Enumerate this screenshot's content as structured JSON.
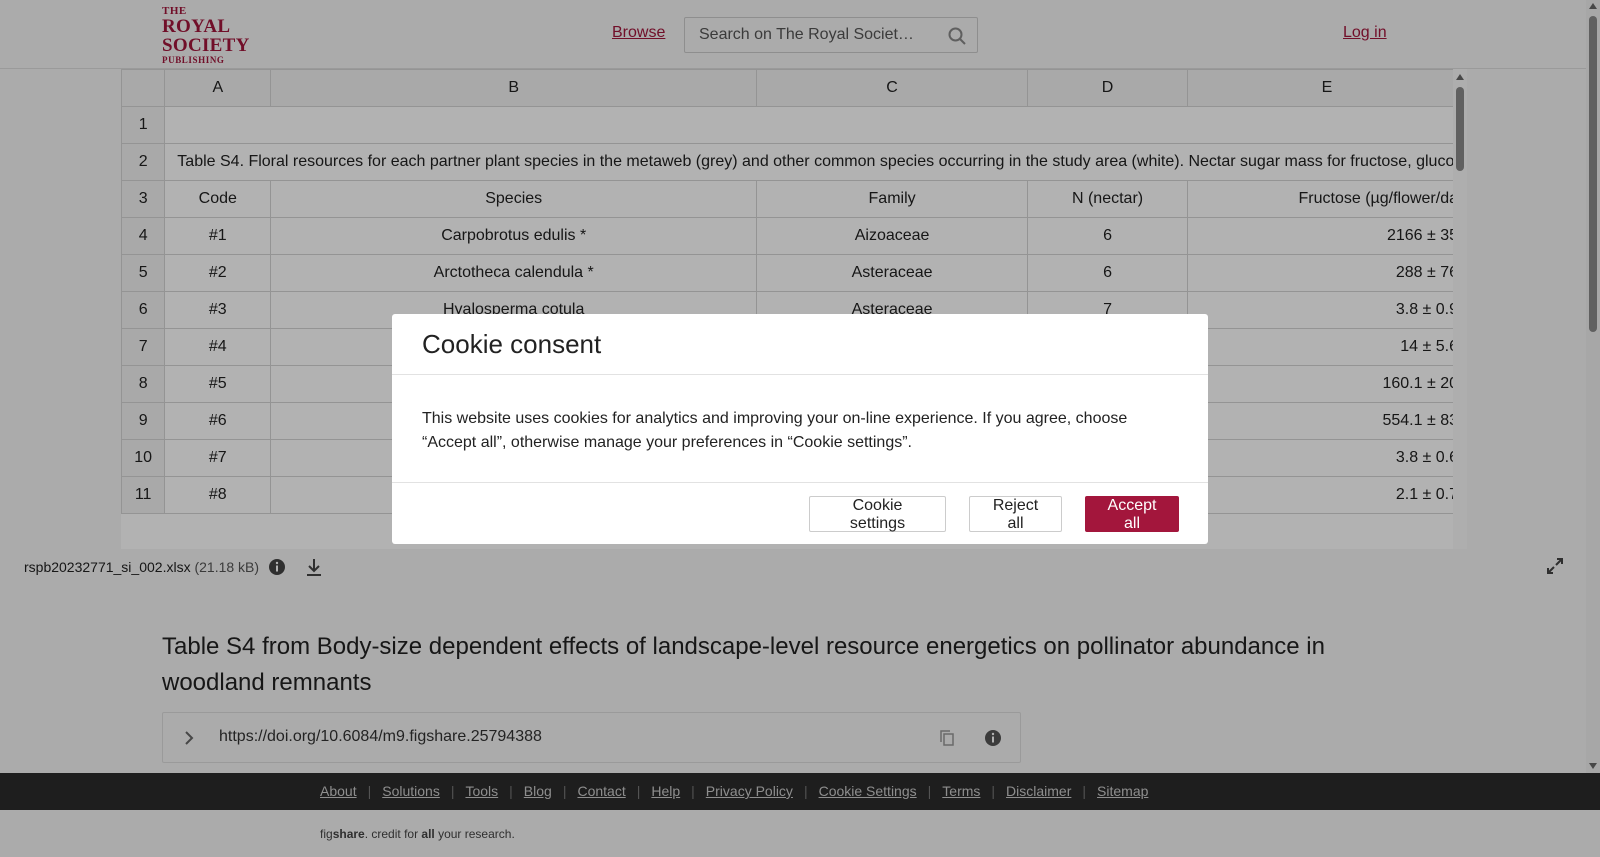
{
  "header": {
    "logo_lines": [
      "THE",
      "ROYAL",
      "SOCIETY",
      "PUBLISHING"
    ],
    "browse_label": "Browse",
    "search_placeholder": "Search on The Royal Societ…",
    "login_label": "Log in"
  },
  "sheet": {
    "columns": [
      "",
      "A",
      "B",
      "C",
      "D",
      "E"
    ],
    "rows": [
      {
        "n": "1",
        "cells": []
      },
      {
        "n": "2",
        "merged": "Table S4. Floral resources for each partner plant species in the metaweb (grey) and other common species occurring in the study area (white). Nectar sugar mass for fructose, gluco"
      },
      {
        "n": "3",
        "cells": [
          "Code",
          "Species",
          "Family",
          "N (nectar)",
          "Fructose (µg/flower/da"
        ]
      },
      {
        "n": "4",
        "cells": [
          "#1",
          "Carpobrotus edulis *",
          "Aizoaceae",
          "6",
          "2166 ± 35"
        ]
      },
      {
        "n": "5",
        "cells": [
          "#2",
          "Arctotheca calendula *",
          "Asteraceae",
          "6",
          "288 ± 76"
        ]
      },
      {
        "n": "6",
        "cells": [
          "#3",
          "Hyalosperma cotula",
          "Asteraceae",
          "7",
          "3.8 ± 0.9"
        ]
      },
      {
        "n": "7",
        "cells": [
          "#4",
          "",
          "",
          "",
          "14 ± 5.6"
        ]
      },
      {
        "n": "8",
        "cells": [
          "#5",
          "",
          "",
          "",
          "160.1 ± 20"
        ]
      },
      {
        "n": "9",
        "cells": [
          "#6",
          "",
          "",
          "",
          "554.1 ± 83"
        ]
      },
      {
        "n": "10",
        "cells": [
          "#7",
          "",
          "",
          "",
          "3.8 ± 0.6"
        ]
      },
      {
        "n": "11",
        "cells": [
          "#8",
          "",
          "",
          "",
          "2.1 ± 0.7"
        ]
      }
    ]
  },
  "file": {
    "name": "rspb20232771_si_002.xlsx",
    "size": "(21.18 kB)"
  },
  "item": {
    "title": "Table S4 from Body-size dependent effects of landscape-level resource energetics on pollinator abundance in woodland remnants",
    "doi": "https://doi.org/10.6084/m9.figshare.25794388"
  },
  "footer": {
    "links": [
      "About",
      "Solutions",
      "Tools",
      "Blog",
      "Contact",
      "Help",
      "Privacy Policy",
      "Cookie Settings",
      "Terms",
      "Disclaimer",
      "Sitemap"
    ],
    "tagline_pre": "fig",
    "tagline_brand": "share",
    "tagline_mid": ". credit for ",
    "tagline_all": "all",
    "tagline_post": " your research."
  },
  "cookie": {
    "title": "Cookie consent",
    "body": "This website uses cookies for analytics and improving your on-line experience. If you agree, choose “Accept all”, otherwise manage your preferences in “Cookie settings”.",
    "settings_label": "Cookie settings",
    "reject_label": "Reject all",
    "accept_label": "Accept all"
  },
  "colors": {
    "brand": "#a3163c",
    "footer_bg": "#2b2b2b"
  }
}
